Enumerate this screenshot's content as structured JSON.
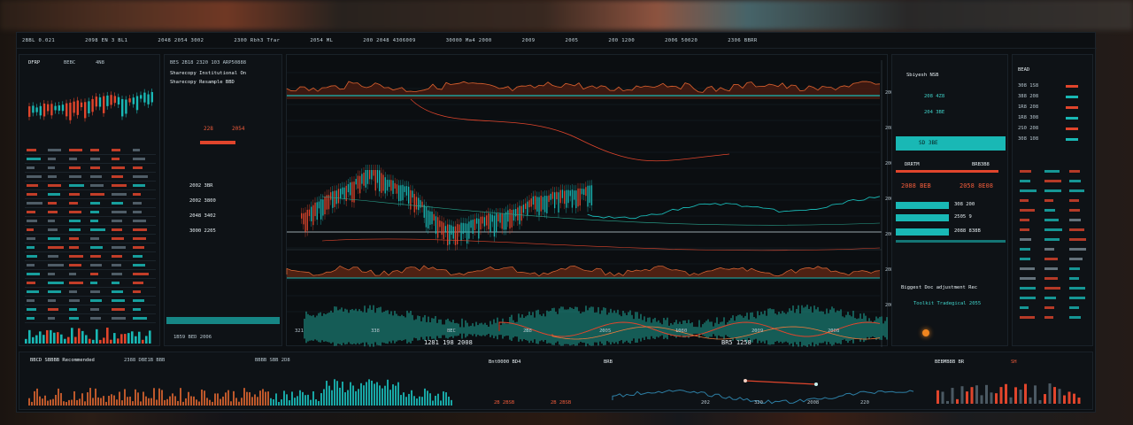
{
  "topbar": {
    "items": [
      "2BBL 0.021",
      "2098  EN  3  BL1",
      "2048  2054 3002",
      "2300  Rbh3 Tfar",
      "2054  ML",
      "200  2048 4306009",
      "30000  Ma4 2000",
      "2009",
      "2005",
      "200  1200",
      "2006  50020",
      "2306  BBRR"
    ]
  },
  "left_panel": {
    "header_a": "DFRP",
    "header_b": "BEBC",
    "header_c": "4N8",
    "rows": [
      "1800  2054",
      "B3C   2058",
      "BRD   1900"
    ]
  },
  "order_panel": {
    "title": "BES  2B18   2320   103  ARP50888",
    "line1": "Sharecopy Institutional On",
    "line2": "Sharecopy Resample BBD",
    "price_a": "228",
    "price_b": "2054",
    "values": [
      "2002 3BR",
      "2002 3800",
      "2048 3402",
      "3000 2205"
    ],
    "footer": "1B59 BED  2006"
  },
  "main_chart": {
    "x_labels": [
      "321",
      "338",
      "BEC",
      "2B8",
      "2005",
      "1080",
      "2009",
      "2008"
    ],
    "center_a": "1281  198  2008",
    "center_b": "BR5  1258",
    "tick_right": [
      "200",
      "208",
      "200",
      "200",
      "200",
      "208",
      "200"
    ]
  },
  "right_panel": {
    "title": "Sbiyesh  NSB",
    "val1": "208 4Z8",
    "val2": "204 3BE",
    "button1": "SD   3BE",
    "button2": "DRRTM",
    "label_mid": "BRB3B8",
    "big_red": "2088 BEB",
    "big_red2": "2058 8E08",
    "cyan1": "308 200",
    "cyan2": "2505 9",
    "cyan3": "2088 838B",
    "note": "Biggest Doc adjustment Rec",
    "note2": "Toolkit Tradegical 2055"
  },
  "far_right": {
    "title": "BEAD",
    "rows": [
      "308  1S8",
      "388  208",
      "1R8  208",
      "1R8  308",
      "2S0  208",
      "308  108"
    ]
  },
  "bottom": {
    "left_title": "BBCD  SBBBB  Recommended",
    "mid_title": "Bnt0000  BD4",
    "vol_label": "BRB",
    "stats": [
      "2388  DBE1B  BBB",
      "BBBB  SBB  2D8",
      "BB8  BB8"
    ],
    "values": [
      "2B 2BSB",
      "2B 2BSB",
      "2B BB8"
    ],
    "axis": [
      "202",
      "320",
      "2008",
      "220"
    ],
    "right_title": "BEBMB8B  BR",
    "right_val": "SH"
  },
  "colors": {
    "accent_cyan": "#19b8b5",
    "accent_red": "#e0452c",
    "background": "#0c0f12"
  }
}
